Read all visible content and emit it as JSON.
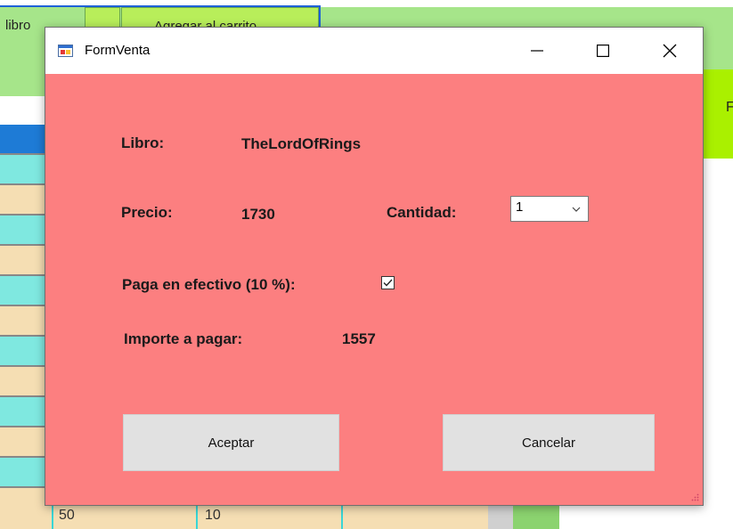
{
  "parent_form": {
    "header_cell": "libro",
    "add_to_cart_button": "Agregar al carrito",
    "right_edge_char": "F",
    "bottom_row": {
      "col1": "50",
      "col2": "10"
    }
  },
  "dialog": {
    "title": "FormVenta",
    "labels": {
      "libro": "Libro:",
      "precio": "Precio:",
      "cantidad": "Cantidad:",
      "paga_efectivo": "Paga en efectivo (10 %):",
      "importe": "Importe a pagar:"
    },
    "values": {
      "libro": "TheLordOfRings",
      "precio": "1730",
      "cantidad": "1",
      "paga_efectivo_checked": true,
      "importe": "1557"
    },
    "buttons": {
      "aceptar": "Aceptar",
      "cancelar": "Cancelar"
    }
  },
  "colors": {
    "dialog_background": "#fc7f80",
    "button_background": "#e1e1e1",
    "parent_green": "#b8ee5a"
  }
}
